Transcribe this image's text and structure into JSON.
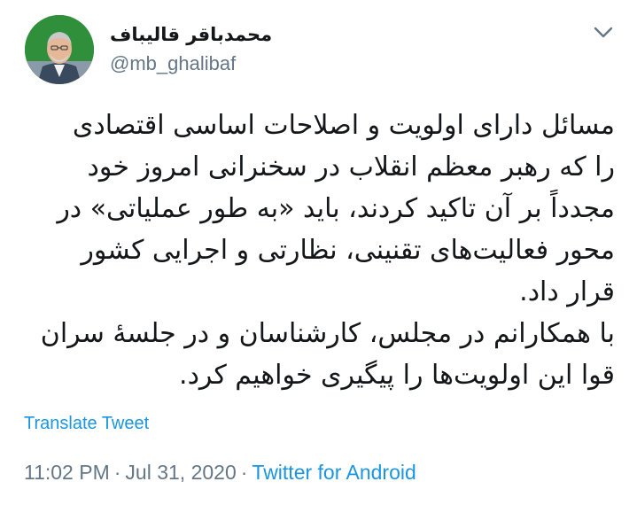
{
  "author": {
    "display_name": "محمدباقر قالیباف",
    "handle": "@mb_ghalibaf",
    "avatar_icon": "profile-photo"
  },
  "tweet": {
    "text": "مسائل دارای اولویت و اصلاحات اساسی اقتصادی\nرا که رهبر معظم انقلاب در سخنرانی امروز خود\nمجدداً بر آن تاکید کردند، باید «به طور عملیاتی» در\nمحور فعالیت‌های تقنینی، نظارتی و اجرایی کشور\nقرار داد.\nبا همکارانم در مجلس، کارشناسان و در جلسهٔ سران\nقوا این اولویت‌ها را پیگیری خواهیم کرد.",
    "translate_label": "Translate Tweet"
  },
  "meta": {
    "time": "11:02 PM",
    "separator": "·",
    "date": "Jul 31, 2020",
    "source": "Twitter for Android"
  },
  "menu": {
    "icon": "chevron-down-icon"
  },
  "colors": {
    "link": "#1b95e0",
    "secondary": "#657786",
    "text": "#14171a",
    "avatar_bg": "#2f8f3a"
  }
}
